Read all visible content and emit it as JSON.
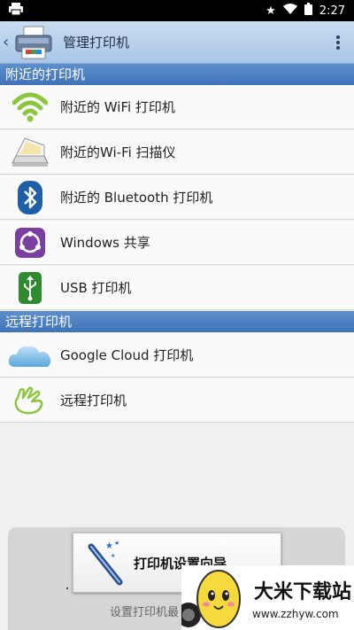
{
  "status_bar": {
    "time": "2:27"
  },
  "app_bar": {
    "title": "管理打印机"
  },
  "sections": {
    "nearby": {
      "header": "附近的打印机",
      "items": [
        {
          "label": "附近的 WiFi 打印机",
          "icon": "wifi-icon"
        },
        {
          "label": "附近的Wi-Fi 扫描仪",
          "icon": "scanner-icon"
        },
        {
          "label": "附近的 Bluetooth 打印机",
          "icon": "bluetooth-icon"
        },
        {
          "label": "Windows 共享",
          "icon": "share-icon"
        },
        {
          "label": "USB 打印机",
          "icon": "usb-icon"
        }
      ]
    },
    "remote": {
      "header": "远程打印机",
      "items": [
        {
          "label": "Google Cloud 打印机",
          "icon": "cloud-icon"
        },
        {
          "label": "远程打印机",
          "icon": "remote-hand-icon"
        }
      ]
    }
  },
  "wizard": {
    "button_label": "打印机设置向导",
    "hint": "设置打印机最"
  },
  "watermark": {
    "brand": "大米下载站",
    "url": "www.zzhyw.com"
  },
  "colors": {
    "section_header": "#4a7fc1",
    "app_bar": "#b7d0ec",
    "wifi_green": "#8cc63f",
    "bluetooth_blue": "#1f5fa8",
    "share_purple": "#7a3fa0",
    "usb_green": "#2e8b2e"
  }
}
